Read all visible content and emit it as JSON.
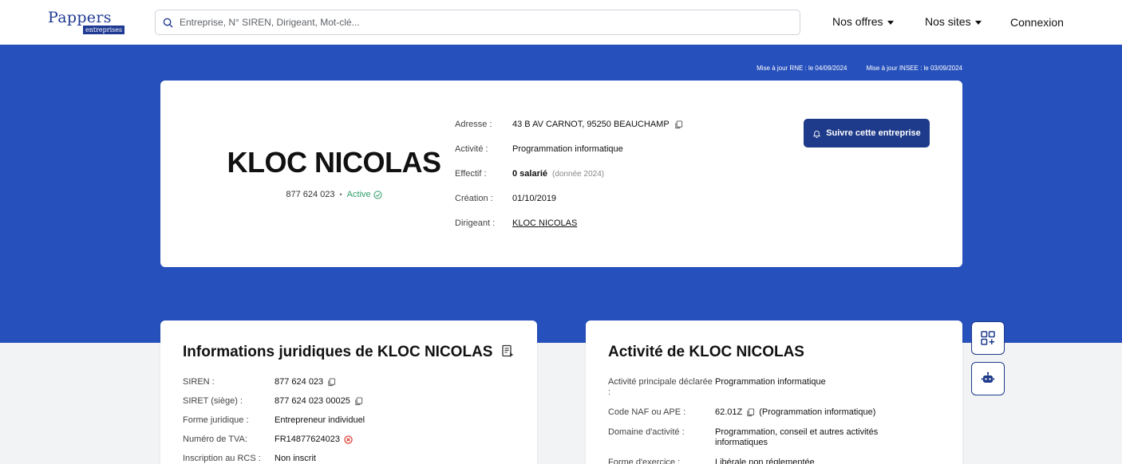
{
  "header": {
    "logo_main": "Pappers",
    "logo_sub": "entreprises",
    "search_placeholder": "Entreprise, N° SIREN, Dirigeant, Mot-clé...",
    "nav": {
      "offers": "Nos offres",
      "sites": "Nos sites",
      "login": "Connexion"
    }
  },
  "updates": {
    "rne": "Mise à jour RNE : le 04/09/2024",
    "insee": "Mise à jour INSEE : le 03/09/2024"
  },
  "company": {
    "name": "KLOC NICOLAS",
    "siren": "877 624 023",
    "separator": "•",
    "status": "Active",
    "follow_button": "Suivre cette entreprise",
    "info": {
      "address_label": "Adresse :",
      "address": "43 B AV CARNOT, 95250 BEAUCHAMP",
      "activity_label": "Activité :",
      "activity": "Programmation informatique",
      "staff_label": "Effectif :",
      "staff": "0 salarié",
      "staff_note": "(donnée 2024)",
      "creation_label": "Création :",
      "creation": "01/10/2019",
      "director_label": "Dirigeant :",
      "director": "KLOC NICOLAS"
    }
  },
  "legal": {
    "title": "Informations juridiques de KLOC NICOLAS",
    "rows": [
      {
        "label": "SIREN :",
        "value": "877 624 023"
      },
      {
        "label": "SIRET (siège) :",
        "value": "877 624 023 00025"
      },
      {
        "label": "Forme juridique :",
        "value": "Entrepreneur individuel"
      },
      {
        "label": "Numéro de TVA:",
        "value": "FR14877624023"
      },
      {
        "label": "Inscription au RCS :",
        "value": "Non inscrit"
      }
    ]
  },
  "activity": {
    "title": "Activité de KLOC NICOLAS",
    "rows": [
      {
        "label": "Activité principale déclarée :",
        "value": "Programmation informatique"
      },
      {
        "label": "Code NAF ou APE :",
        "value": "62.01Z",
        "extra": "(Programmation informatique)"
      },
      {
        "label": "Domaine d'activité :",
        "value": "Programmation, conseil et autres activités informatiques"
      },
      {
        "label": "Forme d'exercice :",
        "value": "Libérale non réglementée"
      }
    ]
  },
  "colors": {
    "brand_blue": "#2650bb",
    "dark_blue": "#1e3a8a",
    "active_green": "#2e9e6a",
    "error_red": "#d93025"
  }
}
